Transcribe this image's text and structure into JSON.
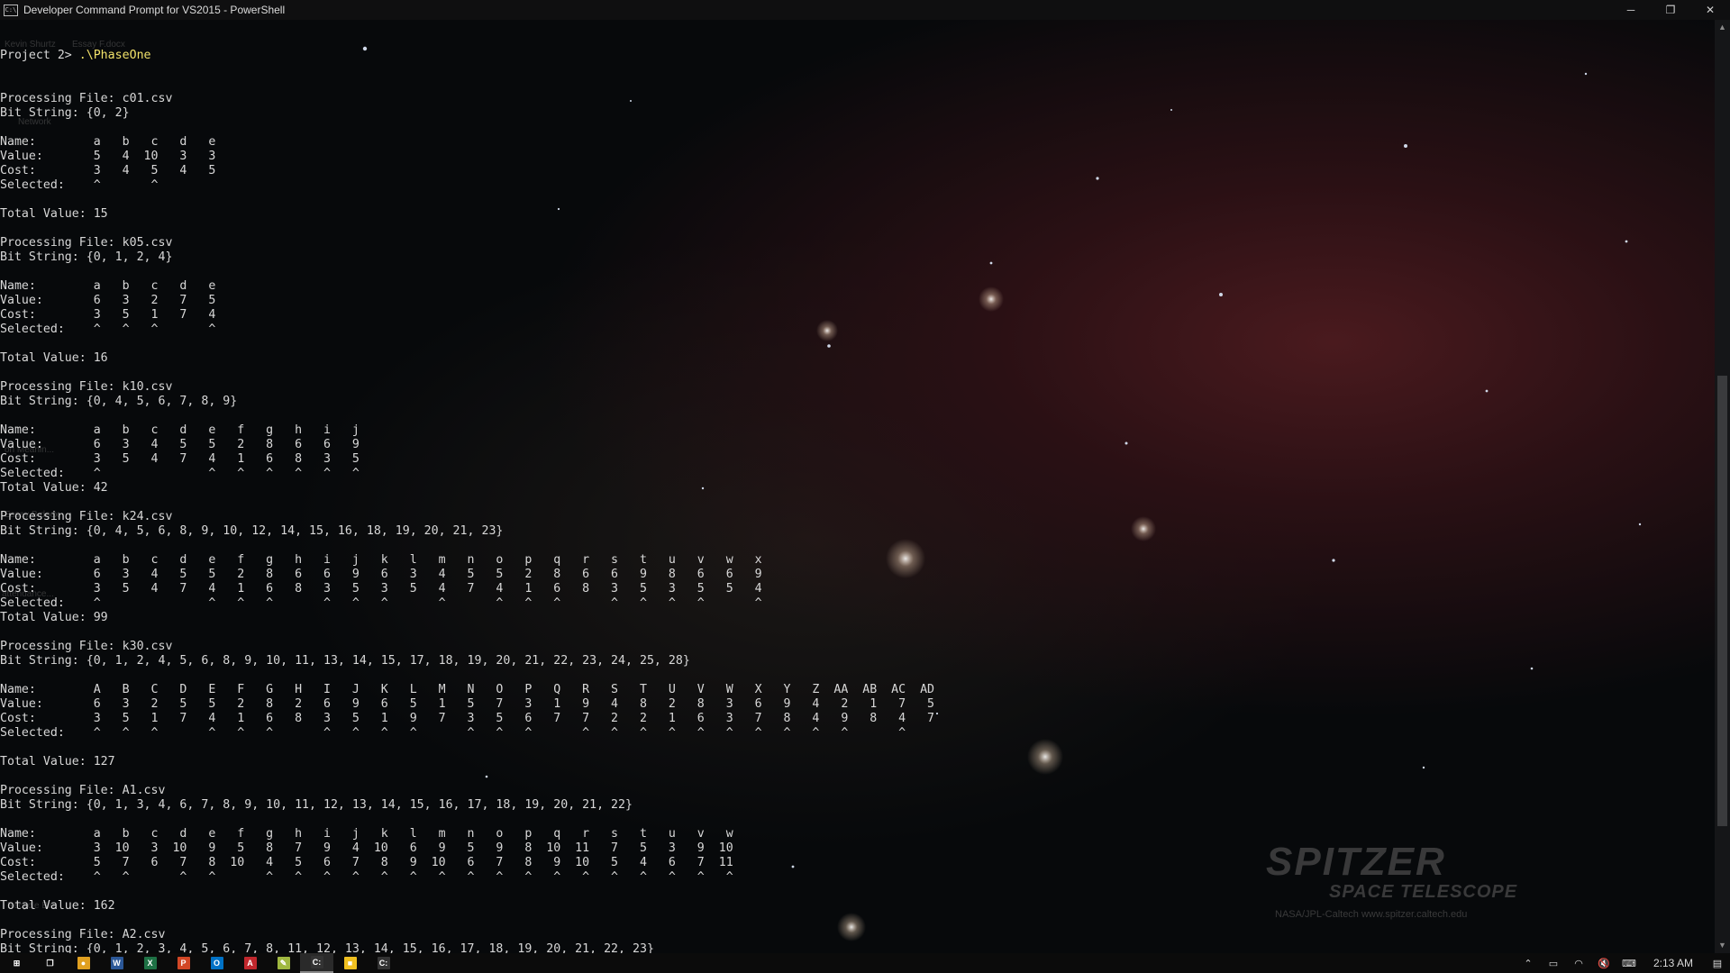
{
  "window": {
    "title": "Developer Command Prompt for VS2015 - PowerShell",
    "icon_text": "C:\\",
    "minimize_label": "─",
    "restore_label": "❐",
    "close_label": "✕"
  },
  "prompt": {
    "prefix": "Project 2> ",
    "command": ".\\PhaseOne"
  },
  "console_lines": [
    "Processing File: c01.csv",
    "Bit String: {0, 2}",
    "",
    "Name:        a   b   c   d   e",
    "Value:       5   4  10   3   3",
    "Cost:        3   4   5   4   5",
    "Selected:    ^       ^",
    "",
    "Total Value: 15",
    "",
    "Processing File: k05.csv",
    "Bit String: {0, 1, 2, 4}",
    "",
    "Name:        a   b   c   d   e",
    "Value:       6   3   2   7   5",
    "Cost:        3   5   1   7   4",
    "Selected:    ^   ^   ^       ^",
    "",
    "Total Value: 16",
    "",
    "Processing File: k10.csv",
    "Bit String: {0, 4, 5, 6, 7, 8, 9}",
    "",
    "Name:        a   b   c   d   e   f   g   h   i   j",
    "Value:       6   3   4   5   5   2   8   6   6   9",
    "Cost:        3   5   4   7   4   1   6   8   3   5",
    "Selected:    ^               ^   ^   ^   ^   ^   ^",
    "Total Value: 42",
    "",
    "Processing File: k24.csv",
    "Bit String: {0, 4, 5, 6, 8, 9, 10, 12, 14, 15, 16, 18, 19, 20, 21, 23}",
    "",
    "Name:        a   b   c   d   e   f   g   h   i   j   k   l   m   n   o   p   q   r   s   t   u   v   w   x",
    "Value:       6   3   4   5   5   2   8   6   6   9   6   3   4   5   5   2   8   6   6   9   8   6   6   9",
    "Cost:        3   5   4   7   4   1   6   8   3   5   3   5   4   7   4   1   6   8   3   5   3   5   5   4",
    "Selected:    ^               ^   ^   ^       ^   ^   ^       ^       ^   ^   ^       ^   ^   ^   ^       ^",
    "Total Value: 99",
    "",
    "Processing File: k30.csv",
    "Bit String: {0, 1, 2, 4, 5, 6, 8, 9, 10, 11, 13, 14, 15, 17, 18, 19, 20, 21, 22, 23, 24, 25, 28}",
    "",
    "Name:        A   B   C   D   E   F   G   H   I   J   K   L   M   N   O   P   Q   R   S   T   U   V   W   X   Y   Z  AA  AB  AC  AD",
    "Value:       6   3   2   5   5   2   8   2   6   9   6   5   1   5   7   3   1   9   4   8   2   8   3   6   9   4   2   1   7   5",
    "Cost:        3   5   1   7   4   1   6   8   3   5   1   9   7   3   5   6   7   7   2   2   1   6   3   7   8   4   9   8   4   7",
    "Selected:    ^   ^   ^       ^   ^   ^       ^   ^   ^   ^       ^   ^   ^       ^   ^   ^   ^   ^   ^   ^   ^   ^   ^       ^",
    "",
    "Total Value: 127",
    "",
    "Processing File: A1.csv",
    "Bit String: {0, 1, 3, 4, 6, 7, 8, 9, 10, 11, 12, 13, 14, 15, 16, 17, 18, 19, 20, 21, 22}",
    "",
    "Name:        a   b   c   d   e   f   g   h   i   j   k   l   m   n   o   p   q   r   s   t   u   v   w",
    "Value:       3  10   3  10   9   5   8   7   9   4  10   6   9   5   9   8  10  11   7   5   3   9  10",
    "Cost:        5   7   6   7   8  10   4   5   6   7   8   9  10   6   7   8   9  10   5   4   6   7  11",
    "Selected:    ^   ^       ^   ^       ^   ^   ^   ^   ^   ^   ^   ^   ^   ^   ^   ^   ^   ^   ^   ^   ^",
    "",
    "Total Value: 162",
    "",
    "Processing File: A2.csv",
    "Bit String: {0, 1, 2, 3, 4, 5, 6, 7, 8, 11, 12, 13, 14, 15, 16, 17, 18, 19, 20, 21, 22, 23}"
  ],
  "desktop_icons": [
    "Kevin Shurtz",
    "Essay F.docx",
    "Network",
    "on Meanin...",
    "Essay B.docx",
    "attendance...",
    "Recycle Bin"
  ],
  "wallpaper": {
    "line1": "SPITZER",
    "line2": "SPACE TELESCOPE",
    "credit": "NASA/JPL-Caltech    www.spitzer.caltech.edu"
  },
  "taskbar": {
    "items": [
      {
        "name": "start-button",
        "icon": "windows-icon",
        "glyph": "⊞",
        "color": "#ffffff"
      },
      {
        "name": "task-view-button",
        "icon": "task-view-icon",
        "glyph": "❐",
        "color": "#ffffff"
      },
      {
        "name": "chrome-button",
        "icon": "chrome-icon",
        "glyph": "●",
        "color": "#e0a020"
      },
      {
        "name": "word-button",
        "icon": "word-icon",
        "glyph": "W",
        "color": "#2b5797"
      },
      {
        "name": "excel-button",
        "icon": "excel-icon",
        "glyph": "X",
        "color": "#1e7145"
      },
      {
        "name": "powerpoint-button",
        "icon": "powerpoint-icon",
        "glyph": "P",
        "color": "#d24726"
      },
      {
        "name": "outlook-button",
        "icon": "outlook-icon",
        "glyph": "O",
        "color": "#0072c6"
      },
      {
        "name": "acrobat-button",
        "icon": "acrobat-icon",
        "glyph": "A",
        "color": "#c1272d"
      },
      {
        "name": "notepad-button",
        "icon": "notepad-icon",
        "glyph": "✎",
        "color": "#a0b840"
      },
      {
        "name": "cmd-button",
        "icon": "cmd-icon",
        "glyph": "C:",
        "color": "#333333"
      },
      {
        "name": "sticky-notes-button",
        "icon": "sticky-notes-icon",
        "glyph": "■",
        "color": "#f0c020"
      },
      {
        "name": "cmd-button-2",
        "icon": "cmd-icon",
        "glyph": "C:",
        "color": "#333333"
      }
    ],
    "active_index": 9,
    "tray": {
      "clock": "2:13 AM"
    }
  }
}
